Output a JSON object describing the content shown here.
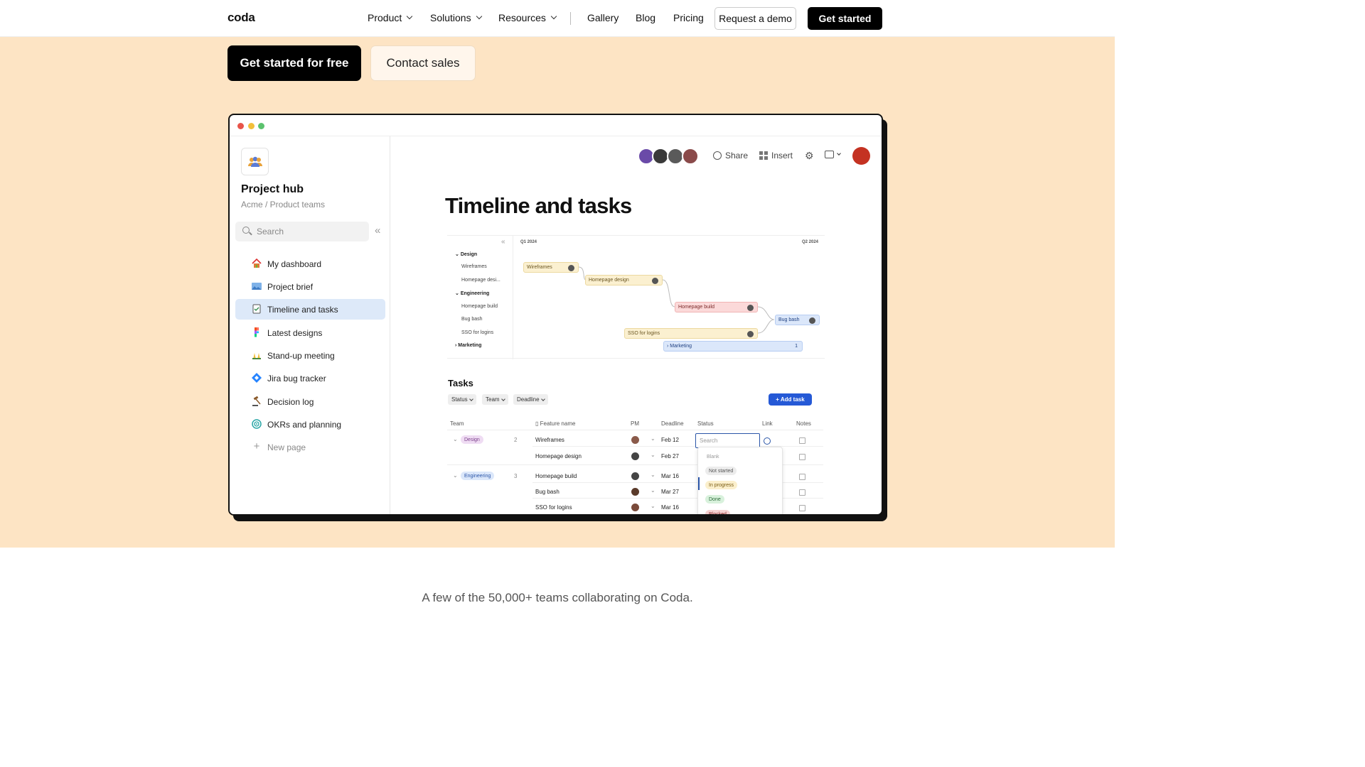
{
  "nav": {
    "logo": "coda",
    "product": "Product",
    "solutions": "Solutions",
    "resources": "Resources",
    "gallery": "Gallery",
    "blog": "Blog",
    "pricing": "Pricing",
    "request_demo": "Request a demo",
    "get_started": "Get started"
  },
  "hero": {
    "cta_primary": "Get started for free",
    "cta_secondary": "Contact sales"
  },
  "colors": {
    "hero_bg": "#fde4c4",
    "accent_blue": "#2559d6",
    "traffic_red": "#e8544a",
    "traffic_yellow": "#f2bf3a",
    "traffic_green": "#5cc26e"
  },
  "sidebar": {
    "hub_icon": "team-icon",
    "title": "Project hub",
    "breadcrumb": "Acme / Product teams",
    "search_placeholder": "Search",
    "items": [
      {
        "label": "My dashboard",
        "icon": "house-icon"
      },
      {
        "label": "Project brief",
        "icon": "landscape-icon"
      },
      {
        "label": "Timeline and tasks",
        "icon": "checklist-icon",
        "active": true
      },
      {
        "label": "Latest designs",
        "icon": "figma-icon"
      },
      {
        "label": "Stand-up meeting",
        "icon": "raised-hands-icon"
      },
      {
        "label": "Jira bug tracker",
        "icon": "jira-icon"
      },
      {
        "label": "Decision log",
        "icon": "gavel-icon"
      },
      {
        "label": "OKRs and planning",
        "icon": "target-icon"
      }
    ],
    "new_page": "New page"
  },
  "doc": {
    "share": "Share",
    "insert": "Insert",
    "title": "Timeline and tasks"
  },
  "timeline": {
    "q1": "Q1 2024",
    "q2": "Q2 2024",
    "rows": [
      "Design",
      "Wireframes",
      "Homepage desi...",
      "Engineering",
      "Homepage build",
      "Bug bash",
      "SSO for logins",
      "Marketing"
    ],
    "bars": {
      "wireframes": "Wireframes",
      "homepage_design": "Homepage design",
      "homepage_build": "Homepage build",
      "bug_bash": "Bug bash",
      "sso": "SSO for logins",
      "marketing": "Marketing",
      "marketing_count": "1"
    }
  },
  "tasks": {
    "title": "Tasks",
    "filters": [
      "Status",
      "Team",
      "Deadline"
    ],
    "add_task": "+ Add task",
    "columns": [
      "Team",
      "Feature name",
      "PM",
      "Deadline",
      "Status",
      "Link",
      "Notes"
    ],
    "groups": [
      {
        "team": "Design",
        "count": "2",
        "rows": [
          {
            "feature": "Wireframes",
            "deadline": "Feb 12"
          },
          {
            "feature": "Homepage design",
            "deadline": "Feb 27"
          }
        ]
      },
      {
        "team": "Engineering",
        "count": "3",
        "rows": [
          {
            "feature": "Homepage build",
            "deadline": "Mar 16"
          },
          {
            "feature": "Bug bash",
            "deadline": "Mar 27"
          },
          {
            "feature": "SSO for logins",
            "deadline": "Mar 16"
          }
        ]
      }
    ],
    "status_search_placeholder": "Search",
    "status_options": [
      "Blank",
      "Not started",
      "In progress",
      "Done",
      "Blocked"
    ]
  },
  "footer_line": "A few of the 50,000+ teams collaborating on Coda."
}
